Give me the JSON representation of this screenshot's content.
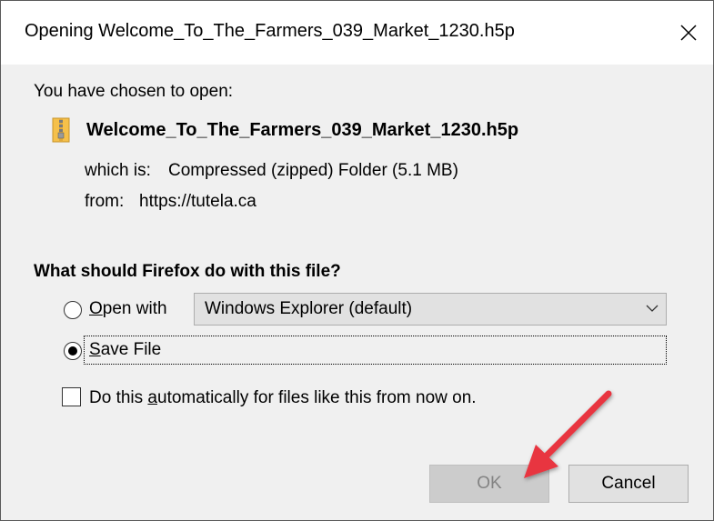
{
  "window": {
    "title": "Opening Welcome_To_The_Farmers_039_Market_1230.h5p",
    "close_glyph": "✕"
  },
  "dialog": {
    "intro": "You have chosen to open:",
    "file_name": "Welcome_To_The_Farmers_039_Market_1230.h5p",
    "file_icon": "zip-folder-icon",
    "which_is_label": "which is:",
    "which_is_value": "Compressed (zipped) Folder (5.1 MB)",
    "from_label": "from:",
    "from_value": "https://tutela.ca",
    "question": "What should Firefox do with this file?",
    "options": {
      "open_with": {
        "label_first": "O",
        "label_rest": "pen with",
        "selected": false
      },
      "application_select": {
        "value": "Windows Explorer (default)"
      },
      "save_file": {
        "label_first": "S",
        "label_rest": "ave File",
        "selected": true
      },
      "auto": {
        "label_before": "Do this ",
        "label_accel": "a",
        "label_after": "utomatically for files like this from now on.",
        "checked": false
      }
    },
    "buttons": {
      "ok": "OK",
      "cancel": "Cancel"
    }
  },
  "annotation": {
    "arrow_color": "#e8343f",
    "arrow_target": "ok-button"
  },
  "colors": {
    "body_bg": "#f0f0f0",
    "title_bg": "#ffffff",
    "button_bg": "#e1e1e1",
    "disabled_button_bg": "#cccccc"
  }
}
